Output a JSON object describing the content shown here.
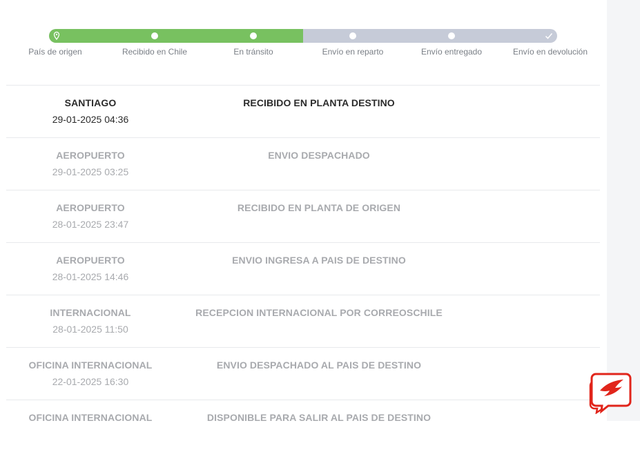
{
  "tracker": {
    "progress_fraction": 0.5,
    "steps": [
      {
        "label": "País de origen",
        "done": true,
        "icon": "location-pin-icon"
      },
      {
        "label": "Recibido en Chile",
        "done": true,
        "icon": "dot"
      },
      {
        "label": "En tránsito",
        "done": true,
        "icon": "dot"
      },
      {
        "label": "Envío en reparto",
        "done": false,
        "icon": "dot"
      },
      {
        "label": "Envío entregado",
        "done": false,
        "icon": "dot"
      },
      {
        "label": "Envío en devolución",
        "done": false,
        "icon": "checkmark-icon"
      }
    ],
    "colors": {
      "done": "#78c160",
      "pending": "#c6cbd8"
    }
  },
  "events": [
    {
      "location": "SANTIAGO",
      "date": "29-01-2025 04:36",
      "status": "RECIBIDO EN PLANTA DESTINO",
      "active": true
    },
    {
      "location": "AEROPUERTO",
      "date": "29-01-2025 03:25",
      "status": "ENVIO DESPACHADO",
      "active": false
    },
    {
      "location": "AEROPUERTO",
      "date": "28-01-2025 23:47",
      "status": "RECIBIDO EN PLANTA DE ORIGEN",
      "active": false
    },
    {
      "location": "AEROPUERTO",
      "date": "28-01-2025 14:46",
      "status": "ENVIO INGRESA A PAIS DE DESTINO",
      "active": false
    },
    {
      "location": "INTERNACIONAL",
      "date": "28-01-2025 11:50",
      "status": "RECEPCION INTERNACIONAL POR CORREOSCHILE",
      "active": false
    },
    {
      "location": "OFICINA INTERNACIONAL",
      "date": "22-01-2025 16:30",
      "status": "ENVIO DESPACHADO AL PAIS DE DESTINO",
      "active": false
    },
    {
      "location": "OFICINA INTERNACIONAL",
      "date": "",
      "status": "DISPONIBLE PARA SALIR AL PAIS DE DESTINO",
      "active": false
    }
  ],
  "chat_widget": {
    "icon": "chat-bubble-icon",
    "color": "#e1251b"
  }
}
